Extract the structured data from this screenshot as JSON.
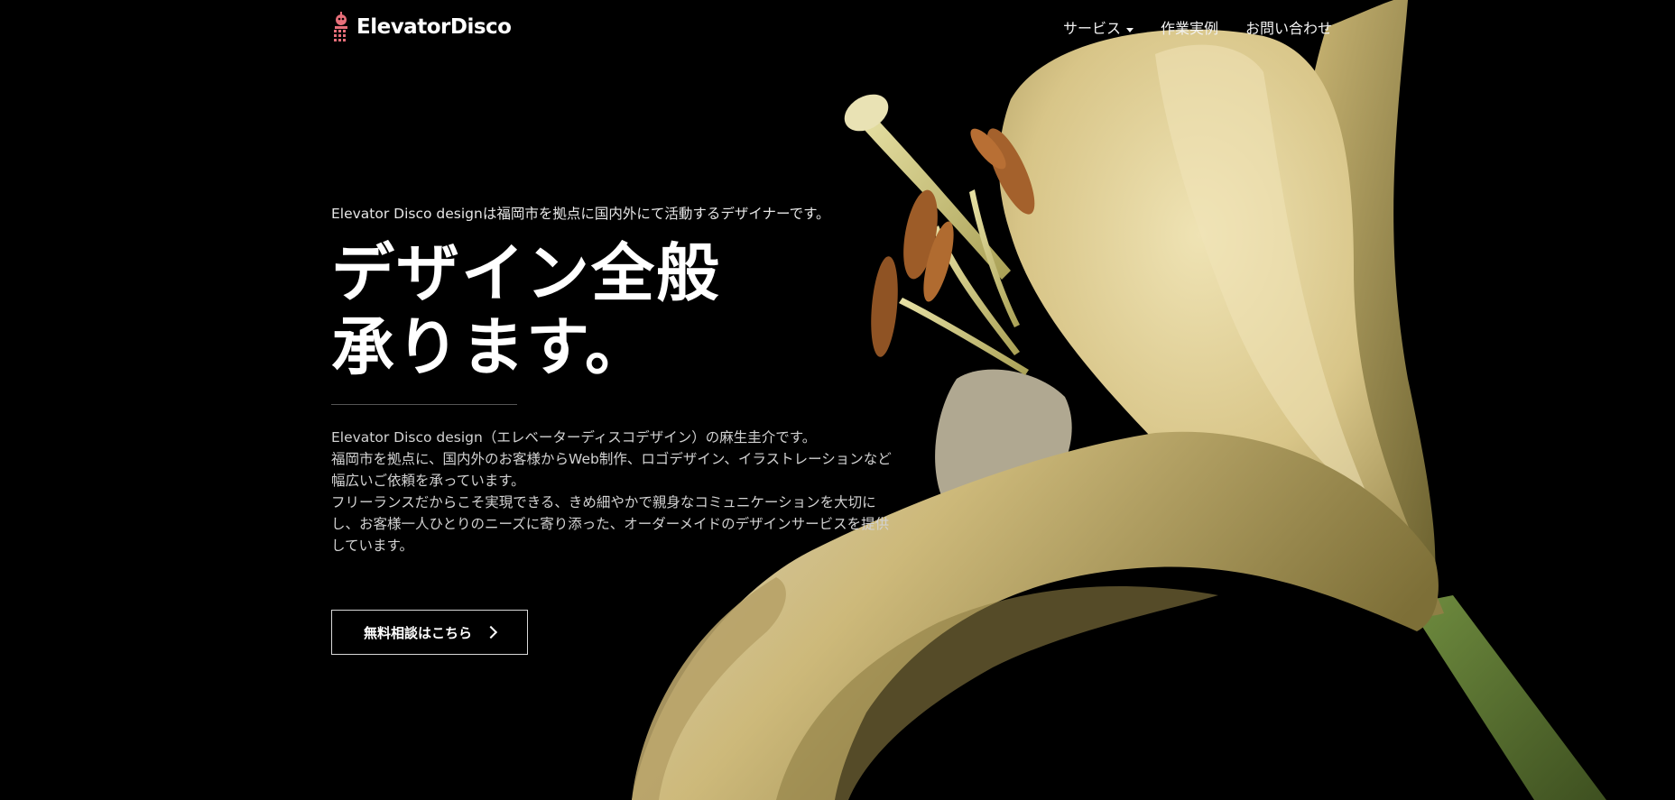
{
  "site": {
    "logo_text": "ElevatorDisco",
    "logo_icon": "disco-robot-icon"
  },
  "nav": {
    "items": [
      {
        "label": "サービス",
        "has_dropdown": true
      },
      {
        "label": "作業実例",
        "has_dropdown": false
      },
      {
        "label": "お問い合わせ",
        "has_dropdown": false
      }
    ]
  },
  "hero": {
    "lead": "Elevator Disco designは福岡市を拠点に国内外にて活動するデザイナーです。",
    "title_line1": "デザイン全般",
    "title_line2": "承ります。",
    "description": [
      "Elevator Disco design（エレベーターディスコデザイン）の麻生圭介です。",
      "福岡市を拠点に、国内外のお客様からWeb制作、ロゴデザイン、イラストレーションなど",
      "幅広いご依頼を承っています。",
      "フリーランスだからこそ実現できる、きめ細やかで親身なコミュニケーションを大切に",
      "し、お客様一人ひとりのニーズに寄り添った、オーダーメイドのデザインサービスを提供",
      "しています。"
    ],
    "cta_label": "無料相談はこちら",
    "cta_icon": "chevron-right-icon"
  },
  "colors": {
    "background": "#000000",
    "text": "#ffffff",
    "logo_accent": "#e76f7a",
    "petal": "#e9d9a4",
    "anther": "#a8642e",
    "stem": "#5e7a36"
  }
}
